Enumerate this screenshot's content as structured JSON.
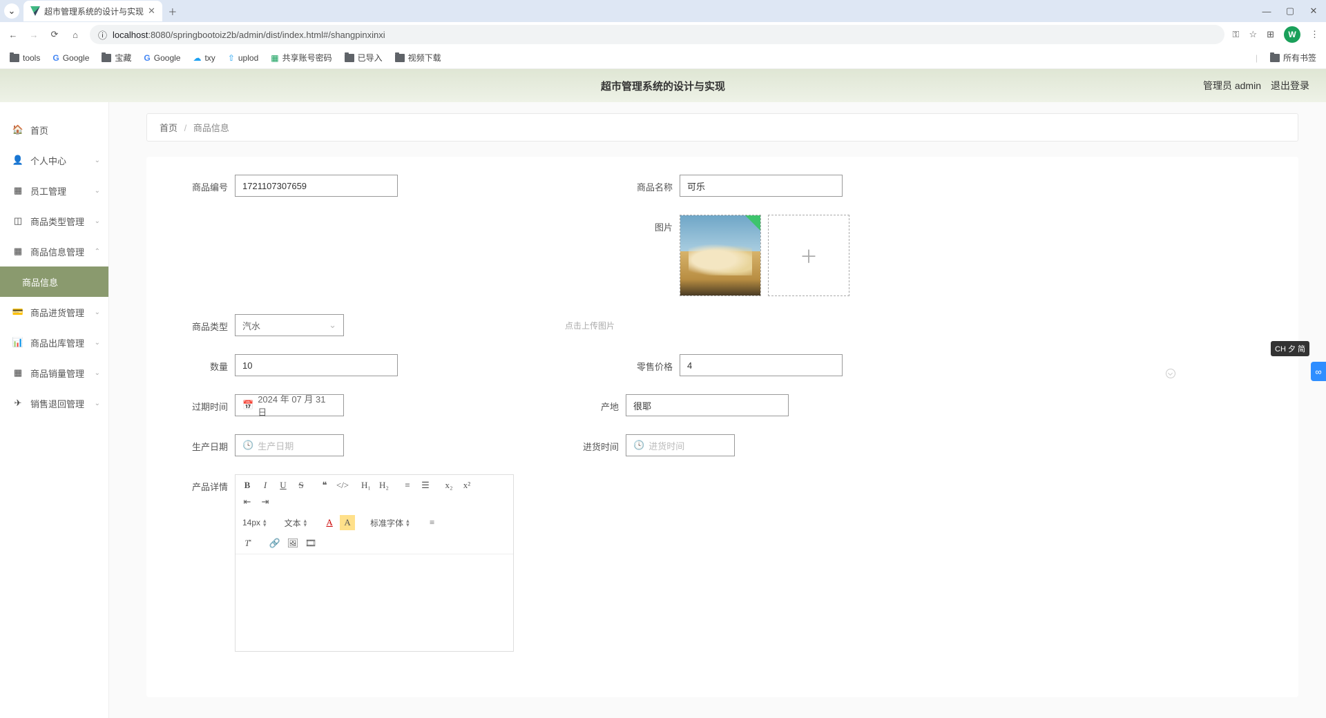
{
  "browser": {
    "tab_title": "超市管理系统的设计与实现",
    "url_host": "localhost",
    "url_path": ":8080/springbootoiz2b/admin/dist/index.html#/shangpinxinxi",
    "avatar_letter": "W"
  },
  "bookmarks": [
    "tools",
    "Google",
    "宝藏",
    "Google",
    "txy",
    "uplod",
    "共享账号密码",
    "已导入",
    "视频下载"
  ],
  "bookmarks_all": "所有书签",
  "header": {
    "title": "超市管理系统的设计与实现",
    "admin": "管理员 admin",
    "logout": "退出登录"
  },
  "sidebar": {
    "items": [
      {
        "label": "首页",
        "icon": "home",
        "expand": false
      },
      {
        "label": "个人中心",
        "icon": "user",
        "expand": true
      },
      {
        "label": "员工管理",
        "icon": "grid",
        "expand": true
      },
      {
        "label": "商品类型管理",
        "icon": "box",
        "expand": true
      },
      {
        "label": "商品信息管理",
        "icon": "grid",
        "expand": true,
        "open": true
      },
      {
        "label": "商品信息",
        "icon": "",
        "sub": true,
        "active": true
      },
      {
        "label": "商品进货管理",
        "icon": "card",
        "expand": true
      },
      {
        "label": "商品出库管理",
        "icon": "chart",
        "expand": true
      },
      {
        "label": "商品销量管理",
        "icon": "grid",
        "expand": true
      },
      {
        "label": "销售退回管理",
        "icon": "send",
        "expand": true
      }
    ]
  },
  "breadcrumb": {
    "home": "首页",
    "current": "商品信息"
  },
  "form": {
    "code_label": "商品编号",
    "code_value": "1721107307659",
    "name_label": "商品名称",
    "name_value": "可乐",
    "image_label": "图片",
    "image_hint": "点击上传图片",
    "type_label": "商品类型",
    "type_value": "汽水",
    "qty_label": "数量",
    "qty_value": "10",
    "price_label": "零售价格",
    "price_value": "4",
    "expire_label": "过期时间",
    "expire_value": "2024 年 07 月 31 日",
    "origin_label": "产地",
    "origin_value": "很耶",
    "prod_date_label": "生产日期",
    "prod_date_placeholder": "生产日期",
    "in_date_label": "进货时间",
    "in_date_placeholder": "进货时间",
    "detail_label": "产品详情"
  },
  "editor": {
    "font_size": "14px",
    "block": "文本",
    "font_family": "标准字体"
  },
  "ime": "CH 夕 简"
}
